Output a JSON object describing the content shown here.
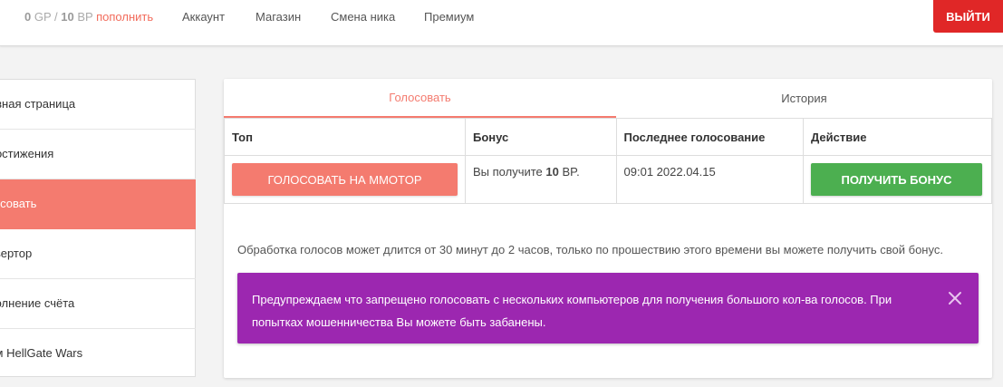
{
  "header": {
    "gp_value": "0",
    "gp_unit": "GP",
    "separator": "/",
    "bp_value": "10",
    "bp_unit": "BP",
    "topup_label": "пополнить",
    "nav": [
      "Аккаунт",
      "Магазин",
      "Смена ника",
      "Премиум"
    ],
    "logout_label": "ВЫЙТИ"
  },
  "sidebar": {
    "items": [
      {
        "label": "Главная страница"
      },
      {
        "label": "Достижения"
      },
      {
        "label": "Голосовать"
      },
      {
        "label": "Конвертор"
      },
      {
        "label": "Пополнение счёта"
      },
      {
        "label": "Форум HellGate Wars"
      }
    ],
    "active_index": 2
  },
  "tabs": [
    {
      "label": "Голосовать"
    },
    {
      "label": "История"
    }
  ],
  "table": {
    "headers": [
      "Топ",
      "Бонус",
      "Последнее голосование",
      "Действие"
    ],
    "row": {
      "vote_button": "ГОЛОСОВАТЬ НА MMOTOP",
      "bonus_prefix": "Вы получите",
      "bonus_amount": "10",
      "bonus_suffix": "BP.",
      "last_vote": "09:01 2022.04.15",
      "bonus_button": "ПОЛУЧИТЬ БОНУС"
    }
  },
  "info_text": "Обработка голосов может длится от 30 минут до 2 часов, только по прошествию этого времени вы можете получить свой бонус.",
  "alert": {
    "text": "Предупреждаем что запрещено голосовать с нескольких компьютеров для получения большого кол-ва голосов. При попытках мошенничества Вы можете быть забанены.",
    "close_icon": "close-icon"
  },
  "colors": {
    "accent": "#f47b6f",
    "logout": "#e02727",
    "success": "#4caf50",
    "alert": "#9c27b0"
  }
}
